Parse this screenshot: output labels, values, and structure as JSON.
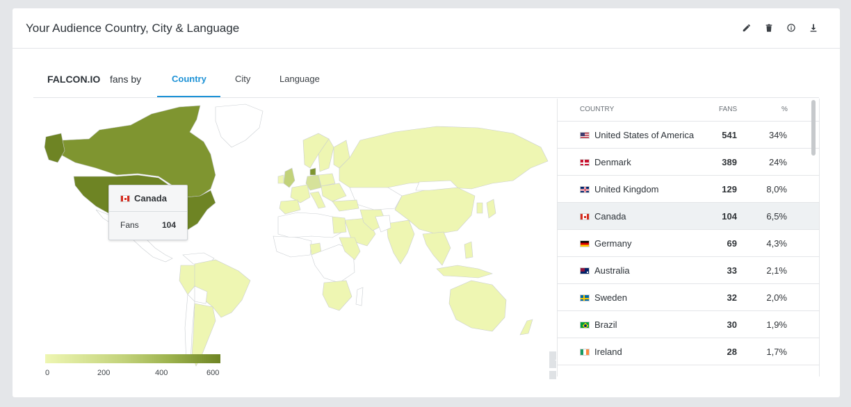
{
  "header": {
    "title": "Your Audience Country, City & Language",
    "actions": [
      {
        "name": "edit-button",
        "icon": "pencil-icon"
      },
      {
        "name": "delete-button",
        "icon": "trash-icon"
      },
      {
        "name": "info-button",
        "icon": "info-icon"
      },
      {
        "name": "download-button",
        "icon": "download-icon"
      }
    ]
  },
  "tabs": {
    "brand": "FALCON.IO",
    "fans_by": "fans by",
    "items": [
      {
        "label": "Country",
        "active": true
      },
      {
        "label": "City",
        "active": false
      },
      {
        "label": "Language",
        "active": false
      }
    ]
  },
  "tooltip": {
    "country": "Canada",
    "flag": "canada-flag-icon",
    "metric_label": "Fans",
    "metric_value": "104"
  },
  "map": {
    "zoom_in": "+",
    "zoom_out": "-",
    "colors": {
      "low": "#eef6b2",
      "mid": "#c2d27a",
      "high": "#6e8424",
      "empty": "#ffffff"
    }
  },
  "legend": {
    "ticks": [
      "0",
      "200",
      "400",
      "600"
    ]
  },
  "table": {
    "columns": {
      "country": "COUNTRY",
      "fans": "FANS",
      "pct": "%"
    },
    "rows": [
      {
        "country": "United States of America",
        "fans": "541",
        "pct": "34%",
        "flag": "usa-flag-icon"
      },
      {
        "country": "Denmark",
        "fans": "389",
        "pct": "24%",
        "flag": "denmark-flag-icon"
      },
      {
        "country": "United Kingdom",
        "fans": "129",
        "pct": "8,0%",
        "flag": "uk-flag-icon"
      },
      {
        "country": "Canada",
        "fans": "104",
        "pct": "6,5%",
        "flag": "canada-flag-icon",
        "highlight": true
      },
      {
        "country": "Germany",
        "fans": "69",
        "pct": "4,3%",
        "flag": "germany-flag-icon"
      },
      {
        "country": "Australia",
        "fans": "33",
        "pct": "2,1%",
        "flag": "australia-flag-icon"
      },
      {
        "country": "Sweden",
        "fans": "32",
        "pct": "2,0%",
        "flag": "sweden-flag-icon"
      },
      {
        "country": "Brazil",
        "fans": "30",
        "pct": "1,9%",
        "flag": "brazil-flag-icon"
      },
      {
        "country": "Ireland",
        "fans": "28",
        "pct": "1,7%",
        "flag": "ireland-flag-icon"
      }
    ]
  }
}
